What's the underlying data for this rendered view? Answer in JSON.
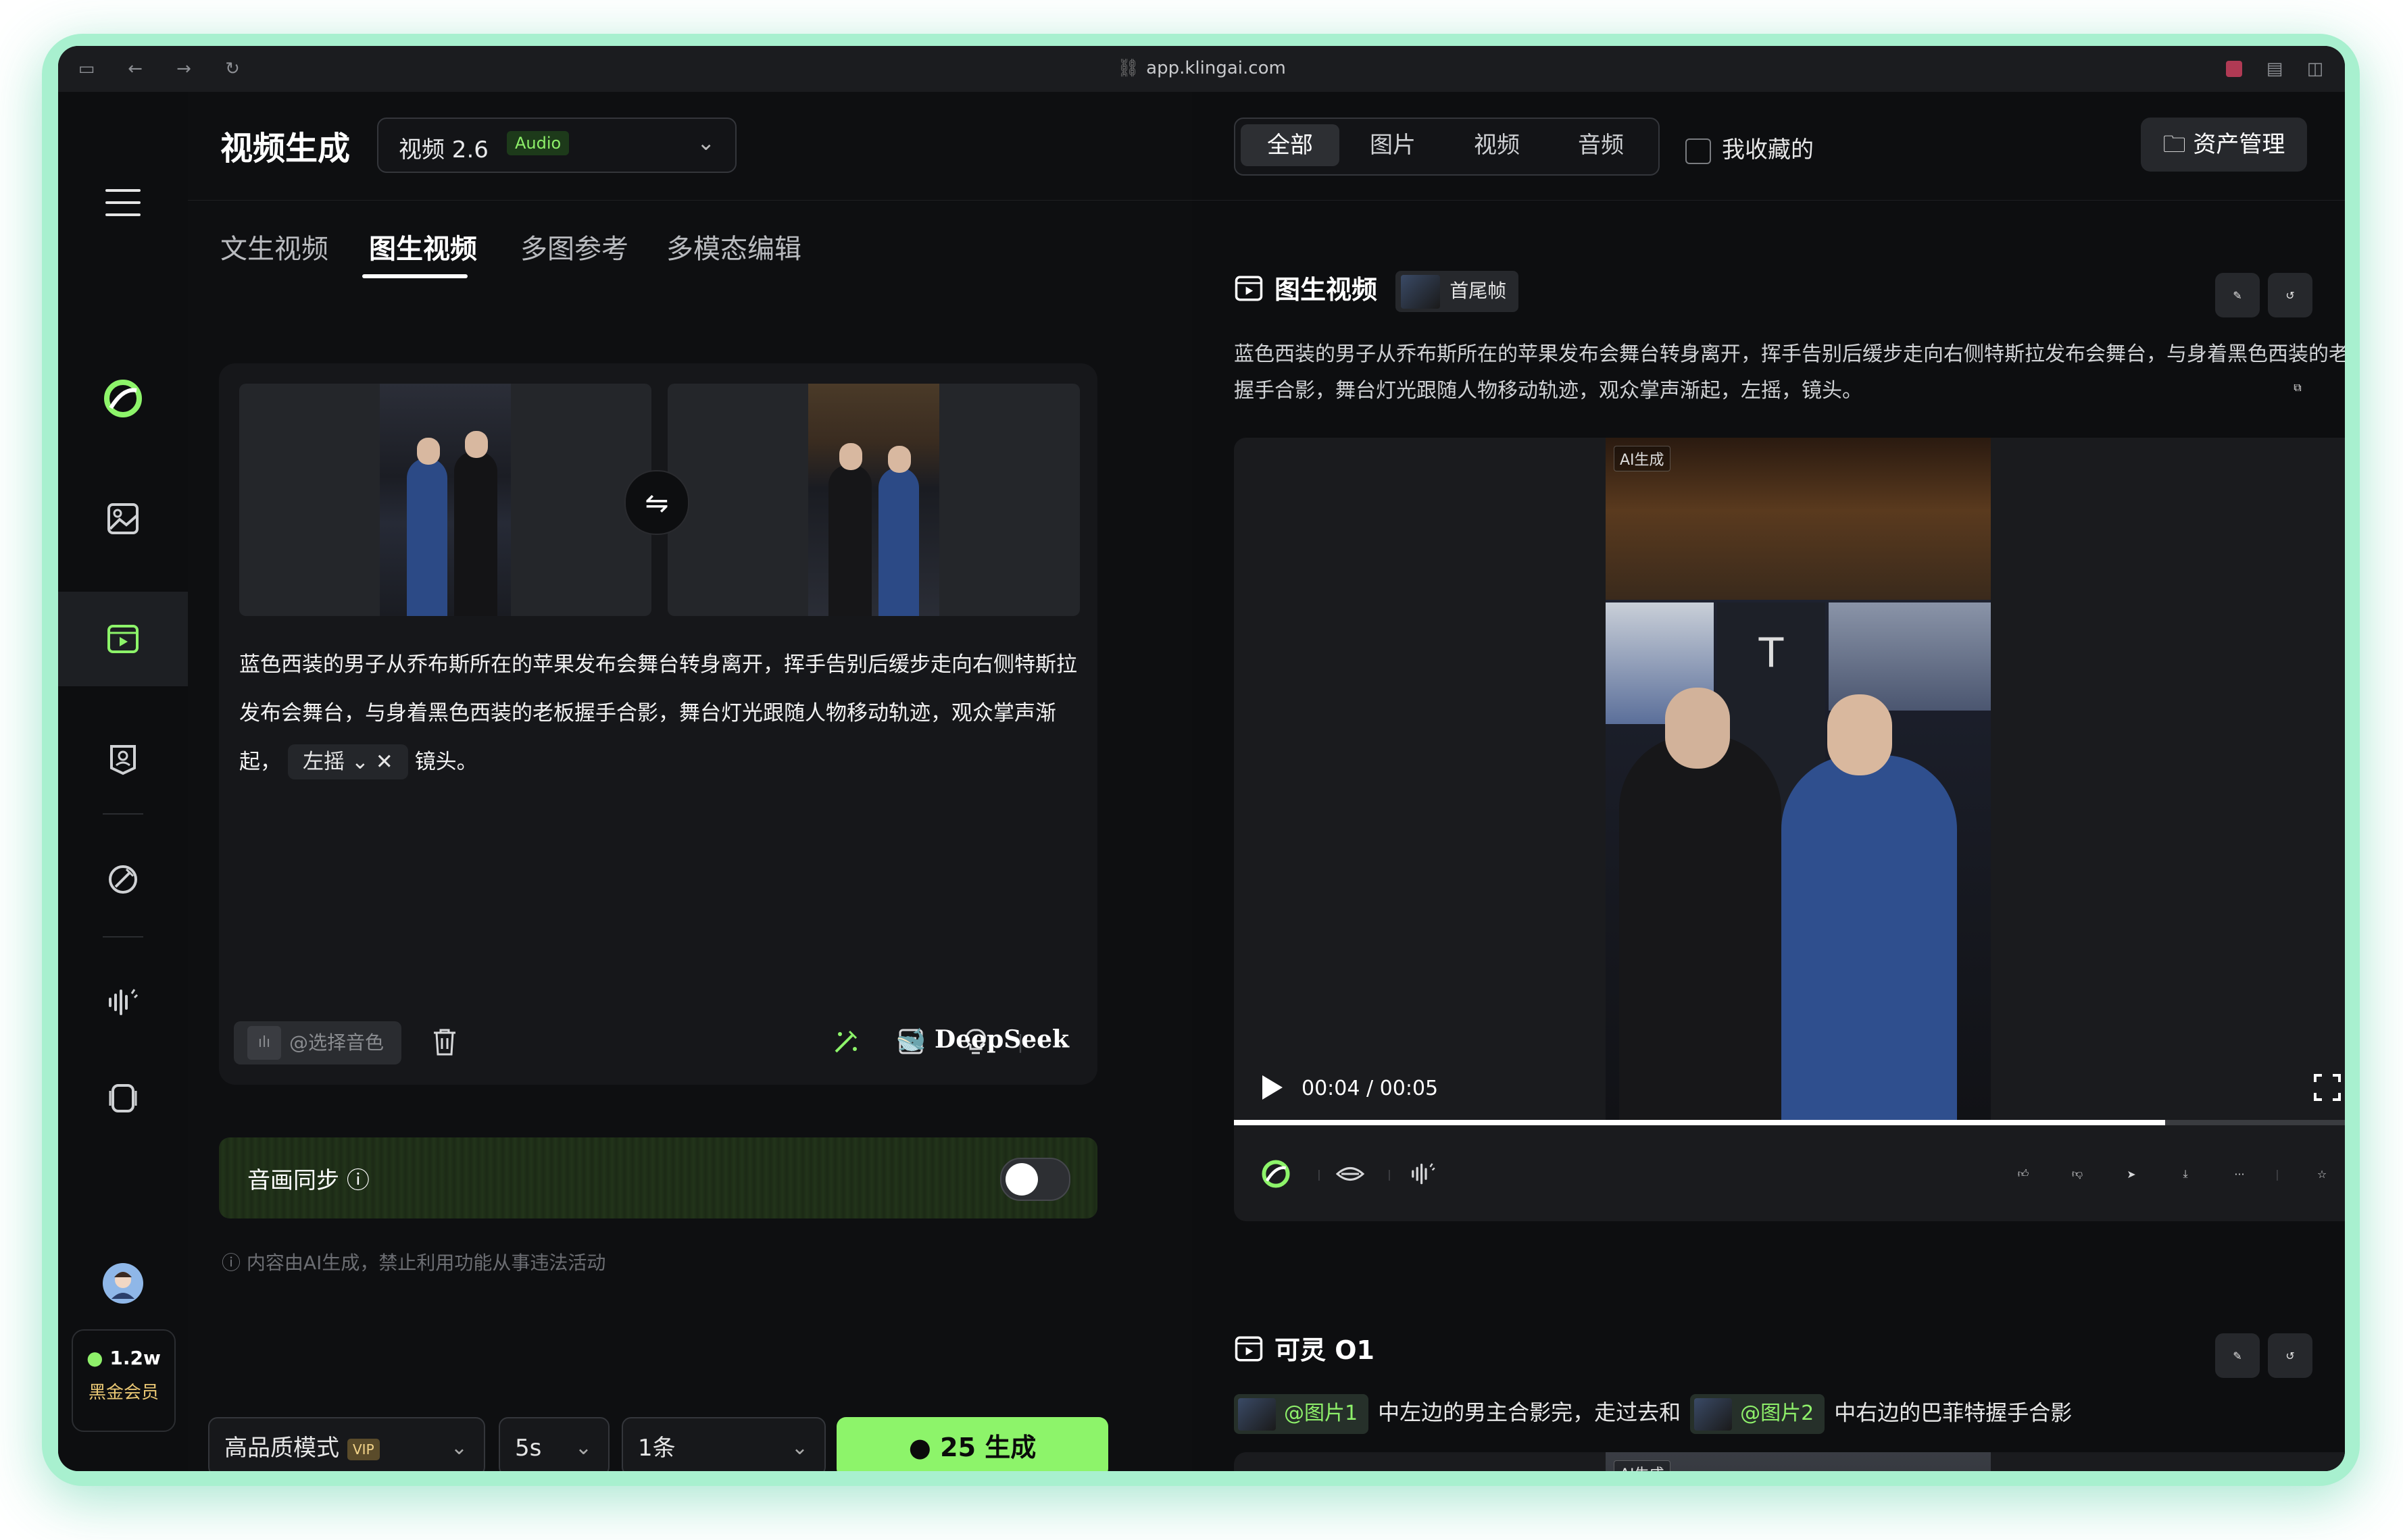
{
  "browser": {
    "url": "app.klingai.com"
  },
  "sidebar": {
    "credits": "1.2w",
    "tier": "黑金会员",
    "more": "···"
  },
  "left": {
    "title": "视频生成",
    "model": {
      "name": "视频 2.6",
      "badge": "Audio"
    },
    "tabs": [
      "文生视频",
      "图生视频",
      "多图参考",
      "多模态编辑"
    ],
    "active_tab": "图生视频",
    "prompt": {
      "text_before": "蓝色西装的男子从乔布斯所在的苹果发布会舞台转身离开，挥手告别后缓步走向右侧特斯拉发布会舞台，与身着黑色西装的老板握手合影，舞台灯光跟随人物移动轨迹，观众掌声渐起，",
      "camera_chip": "左摇",
      "text_after": "镜头。"
    },
    "voice_placeholder": "@选择音色",
    "deepseek_label": "DeepSeek",
    "sync": {
      "label": "音画同步",
      "enabled": false
    },
    "notice": "内容由AI生成，禁止利用功能从事违法活动",
    "controls": {
      "quality": "高品质模式",
      "quality_badge": "VIP",
      "duration": "5s",
      "count": "1条",
      "generate_cost": "25",
      "generate_label": "生成"
    }
  },
  "right": {
    "filters": [
      "全部",
      "图片",
      "视频",
      "音频"
    ],
    "active_filter": "全部",
    "favorites_label": "我收藏的",
    "asset_button": "资产管理",
    "item1": {
      "title": "图生视频",
      "tag": "首尾帧",
      "description": "蓝色西装的男子从乔布斯所在的苹果发布会舞台转身离开，挥手告别后缓步走向右侧特斯拉发布会舞台，与身着黑色西装的老板握手合影，舞台灯光跟随人物移动轨迹，观众掌声渐起，左摇，镜头。",
      "ai_mark": "AI生成",
      "time_current": "00:04",
      "time_total": "00:05",
      "progress": 0.825
    },
    "item2": {
      "title": "可灵 O1",
      "ref1": "@图片1",
      "text1": "中左边的男主合影完，走过去和",
      "ref2": "@图片2",
      "text2": "中右边的巴菲特握手合影",
      "ai_mark": "AI生成"
    }
  },
  "colors": {
    "accent": "#8df46a",
    "background": "#0d0e10",
    "panel": "#16171a",
    "halo": "#a8f0cf"
  }
}
